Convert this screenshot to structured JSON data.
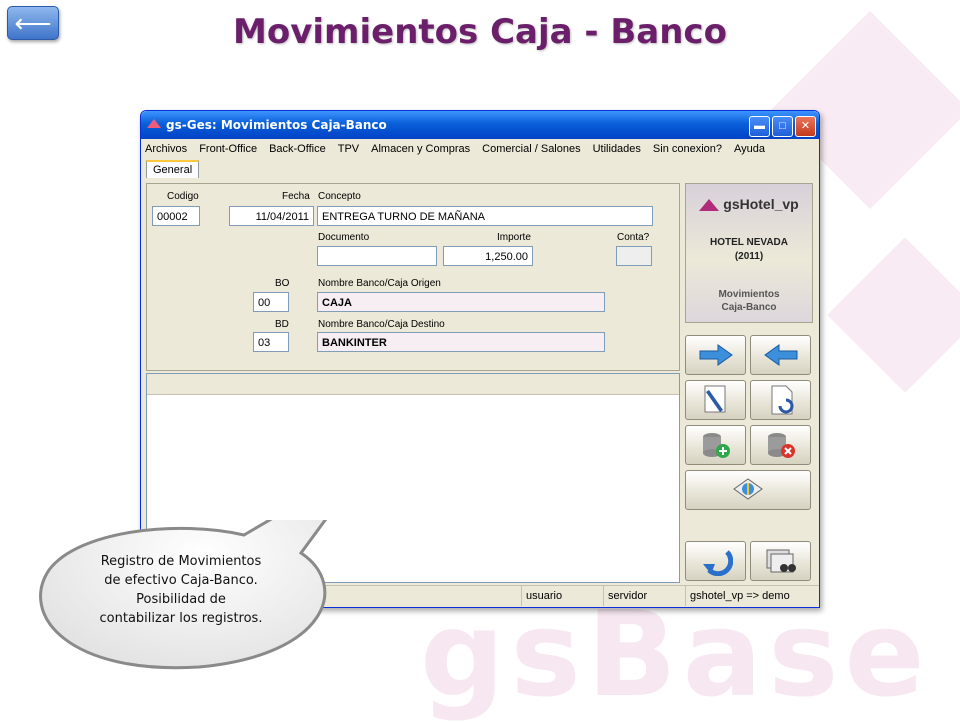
{
  "slide": {
    "title": "Movimientos Caja - Banco",
    "back_icon": "back-arrow-icon",
    "watermark": "gsBase"
  },
  "window": {
    "title": "gs-Ges: Movimientos Caja-Banco",
    "controls": [
      "minimize-icon",
      "maximize-icon",
      "close-icon"
    ]
  },
  "menu": {
    "items": [
      "Archivos",
      "Front-Office",
      "Back-Office",
      "TPV",
      "Almacen y Compras",
      "Comercial / Salones",
      "Utilidades",
      "Sin conexion?",
      "Ayuda"
    ]
  },
  "tabs": {
    "active": "General"
  },
  "form": {
    "codigo_label": "Codigo",
    "codigo_value": "00002",
    "fecha_label": "Fecha",
    "fecha_value": "11/04/2011",
    "concepto_label": "Concepto",
    "concepto_value": "ENTREGA TURNO DE MAÑANA",
    "documento_label": "Documento",
    "documento_value": "",
    "importe_label": "Importe",
    "importe_value": "1,250.00",
    "conta_label": "Conta?",
    "conta_value": "",
    "bo_label": "BO",
    "bo_value": "00",
    "origen_label": "Nombre Banco/Caja Origen",
    "origen_value": "CAJA",
    "bd_label": "BD",
    "bd_value": "03",
    "destino_label": "Nombre Banco/Caja Destino",
    "destino_value": "BANKINTER"
  },
  "brand": {
    "name": "gsHotel_vp",
    "hotel_line1": "HOTEL NEVADA",
    "hotel_line2": "(2011)",
    "module_line1": "Movimientos",
    "module_line2": "Caja-Banco"
  },
  "side_buttons": [
    "next-arrow-icon",
    "previous-arrow-icon",
    "edit-document-icon",
    "refresh-document-icon",
    "add-record-icon",
    "delete-record-icon",
    "accounting-icon",
    "exit-icon",
    "search-records-icon"
  ],
  "status": {
    "usuario": "usuario",
    "servidor": "servidor",
    "connection": "gshotel_vp => demo"
  },
  "callout": {
    "line1": "Registro de Movimientos",
    "line2": "de efectivo Caja-Banco.",
    "line3": "Posibilidad de",
    "line4": "contabilizar los registros."
  },
  "colors": {
    "title": "#6b1f6b",
    "titlebar": "#0a5fd8",
    "accent": "#b02c78"
  }
}
